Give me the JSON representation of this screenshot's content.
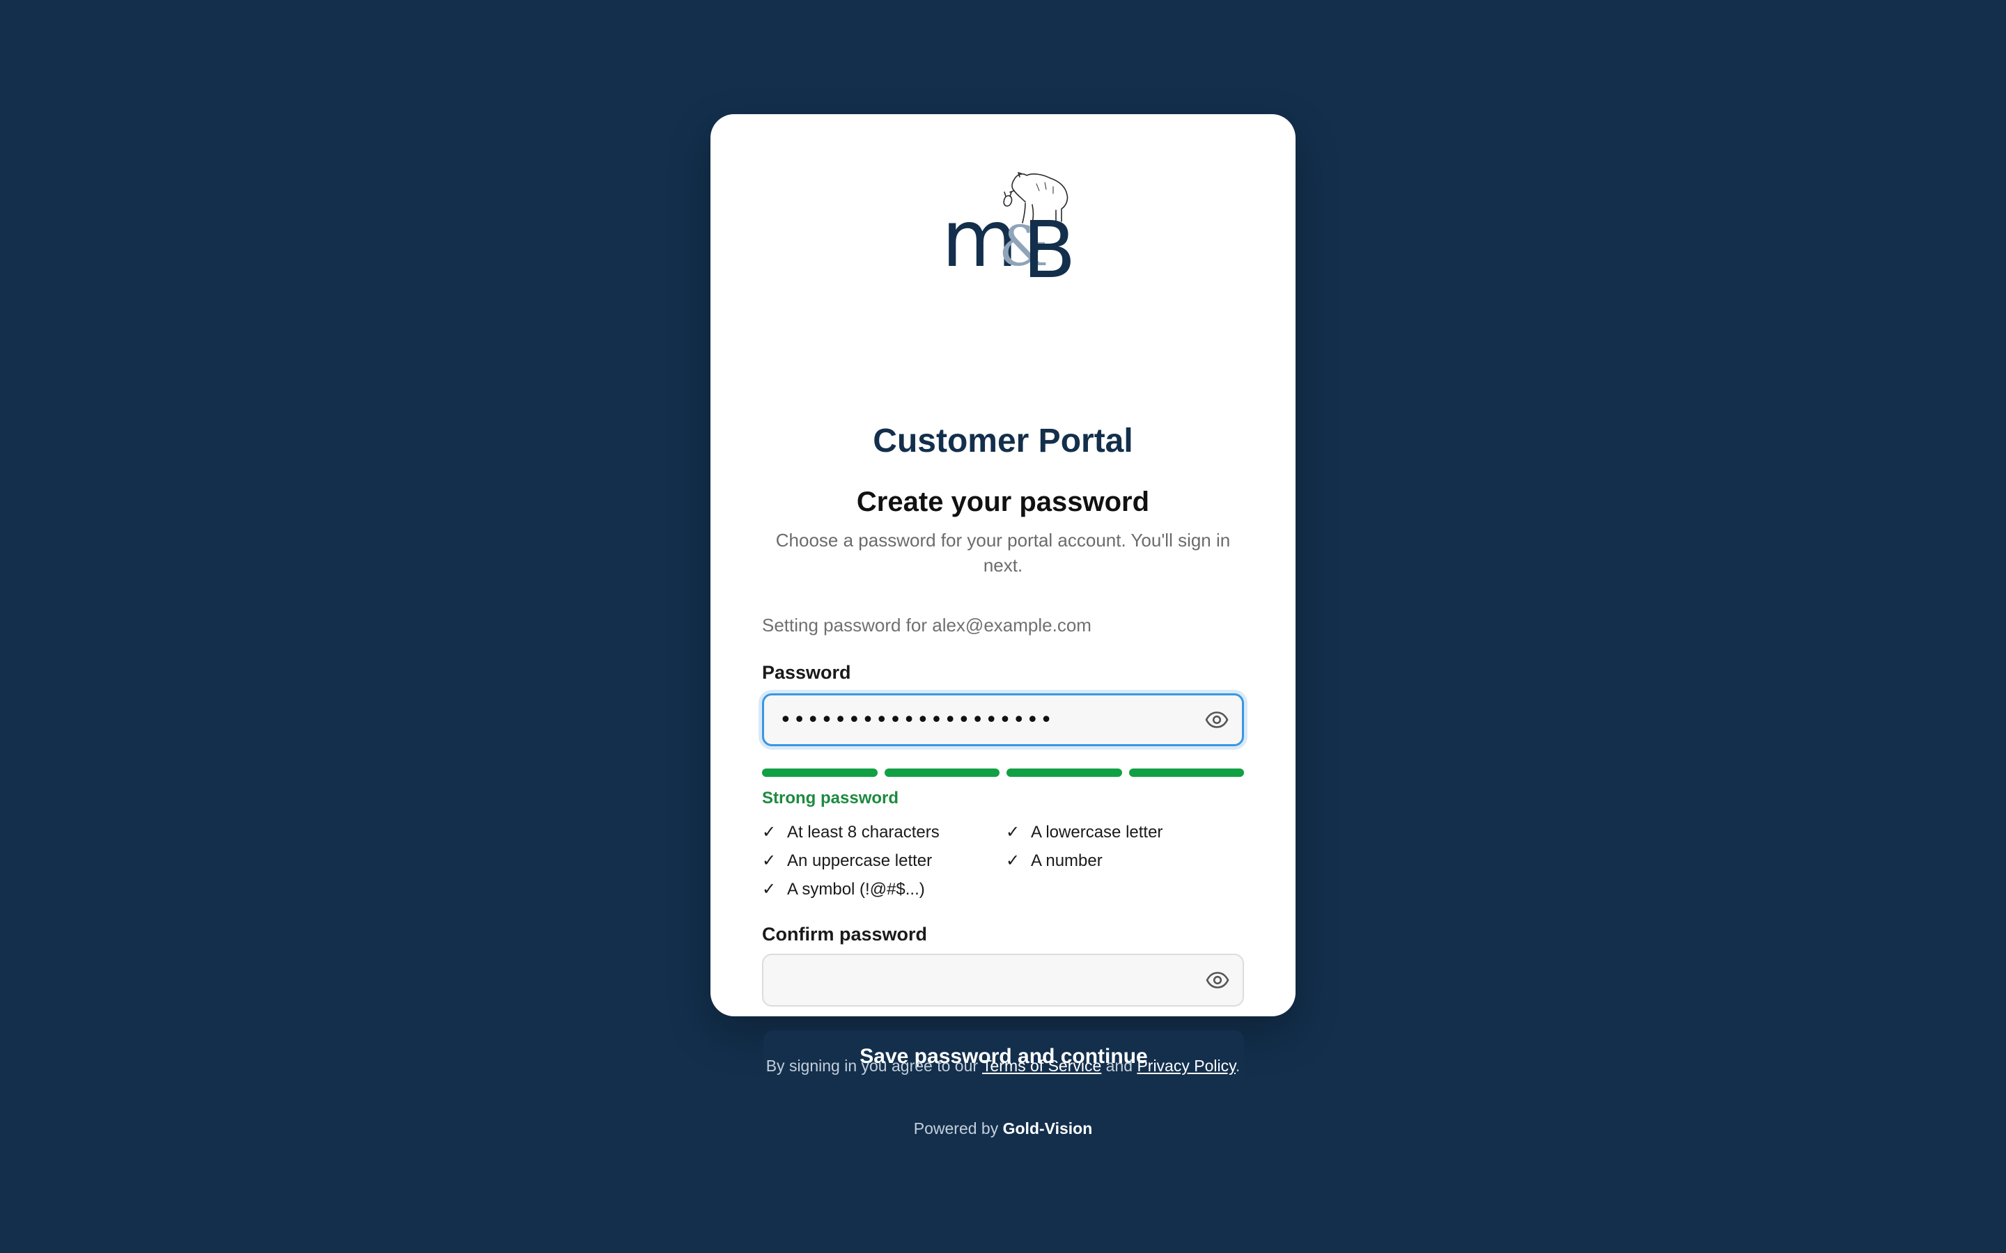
{
  "brand": {
    "logo_letters": [
      "m",
      "&",
      "B"
    ],
    "portal_title": "Customer Portal",
    "primary_color": "#132f4c",
    "accent_color": "#11a043",
    "logo_icon": "bear-icon"
  },
  "form": {
    "heading": "Create your password",
    "subtext": "Choose a password for your portal account. You'll sign in next.",
    "setting_for": "Setting password for alex@example.com",
    "password": {
      "label": "Password",
      "value": "••••••••••••••••••••",
      "toggle_icon": "eye-icon"
    },
    "strength": {
      "segments_filled": 4,
      "segments_total": 4,
      "label": "Strong password"
    },
    "rules": [
      {
        "check": "✓",
        "text": "At least 8 characters"
      },
      {
        "check": "✓",
        "text": "A lowercase letter"
      },
      {
        "check": "✓",
        "text": "An uppercase letter"
      },
      {
        "check": "✓",
        "text": "A number"
      },
      {
        "check": "✓",
        "text": "A symbol (!@#$...)"
      }
    ],
    "confirm": {
      "label": "Confirm password",
      "value": "",
      "toggle_icon": "eye-icon"
    },
    "submit_label": "Save password and continue"
  },
  "footer": {
    "terms_prefix": "By signing in you agree to our",
    "terms_link": "Terms of Service",
    "and_text": "and",
    "privacy_link": "Privacy Policy",
    "end_text": ".",
    "powered_prefix": "Powered by",
    "powered_brand": "Gold-Vision"
  }
}
